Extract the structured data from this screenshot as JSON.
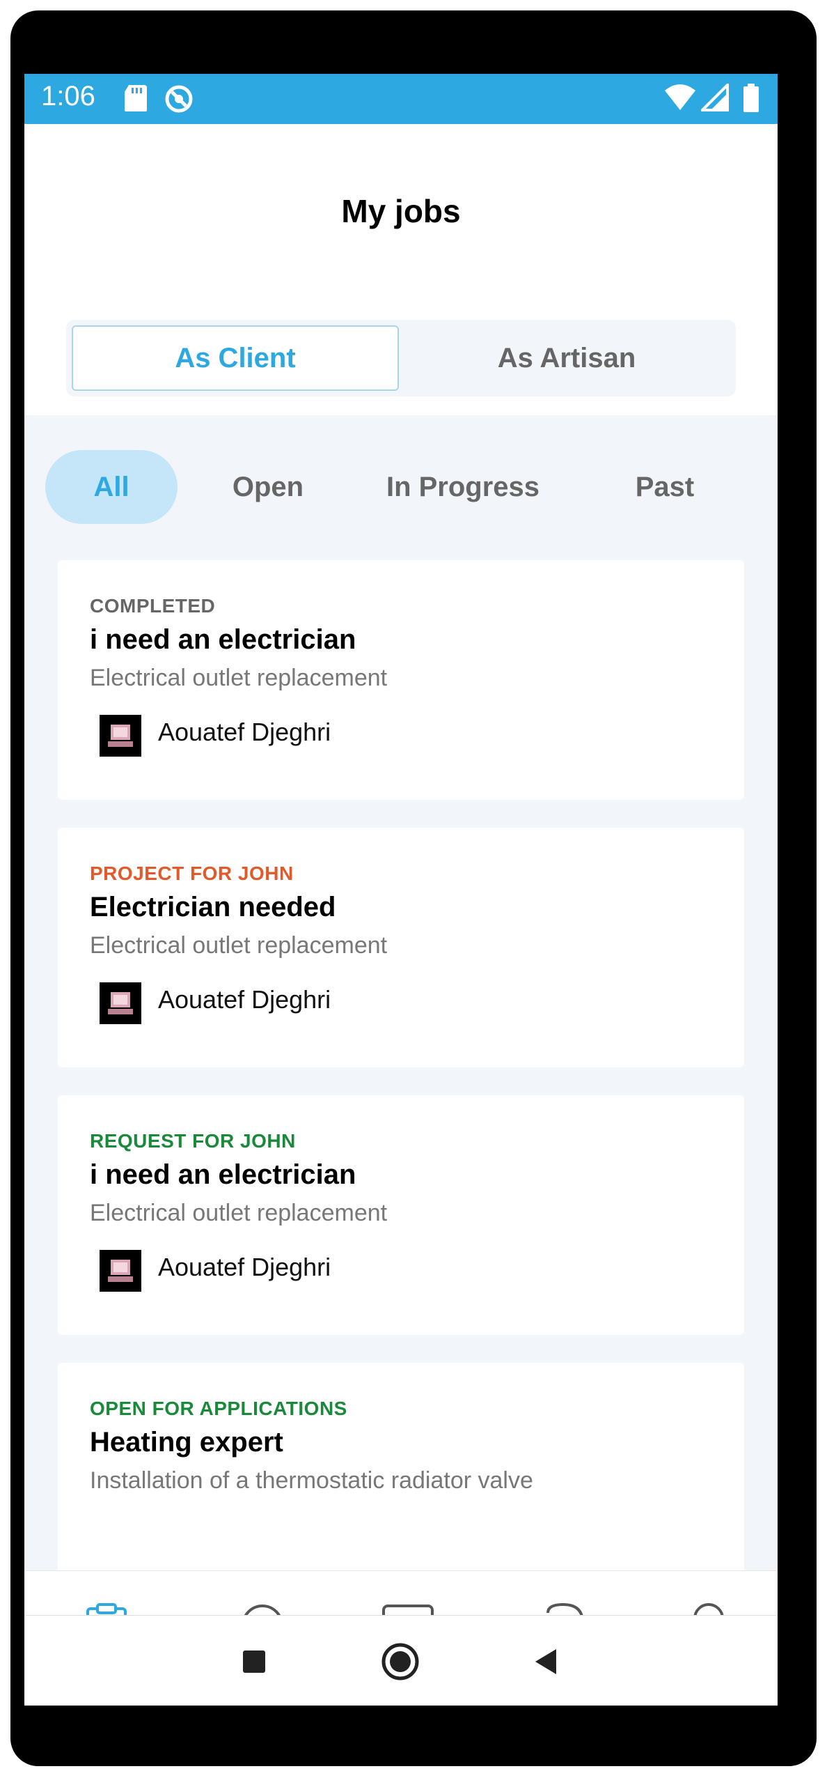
{
  "status_bar": {
    "time": "1:06",
    "color": "#2ea8e0",
    "icons": [
      "sd-card-icon",
      "sync-icon",
      "wifi-icon",
      "signal-icon",
      "battery-icon"
    ]
  },
  "header": {
    "title": "My jobs",
    "role_tabs": [
      {
        "label": "As Client",
        "active": true
      },
      {
        "label": "As Artisan",
        "active": false
      }
    ]
  },
  "filters": [
    {
      "label": "All",
      "active": true
    },
    {
      "label": "Open",
      "active": false
    },
    {
      "label": "In Progress",
      "active": false
    },
    {
      "label": "Past",
      "active": false
    }
  ],
  "jobs": [
    {
      "status": "COMPLETED",
      "status_color": "#666666",
      "title": "i need an electrician",
      "description": "Electrical outlet replacement",
      "person": "Aouatef Djeghri"
    },
    {
      "status": "PROJECT FOR JOHN",
      "status_color": "#e05a2b",
      "title": "Electrician needed",
      "description": "Electrical outlet replacement",
      "person": "Aouatef Djeghri"
    },
    {
      "status": "REQUEST FOR JOHN",
      "status_color": "#1a8a3a",
      "title": "i need an electrician",
      "description": "Electrical outlet replacement",
      "person": "Aouatef Djeghri"
    },
    {
      "status": "OPEN FOR APPLICATIONS",
      "status_color": "#1a8a3a",
      "title": "Heating expert",
      "description": "Installation of a thermostatic radiator valve",
      "person": ""
    }
  ],
  "bottom_nav": [
    {
      "icon": "clipboard-check-icon",
      "active": true
    },
    {
      "icon": "search-icon",
      "active": false
    },
    {
      "icon": "add-square-icon",
      "active": false
    },
    {
      "icon": "chat-bubbles-icon",
      "active": false
    },
    {
      "icon": "profile-icon",
      "active": false
    }
  ],
  "system_nav": [
    "recents-square-icon",
    "home-circle-icon",
    "back-triangle-icon"
  ],
  "colors": {
    "accent": "#2ea8e0",
    "chip_active_bg": "#c5e5f9",
    "content_bg": "#f2f6fb"
  }
}
